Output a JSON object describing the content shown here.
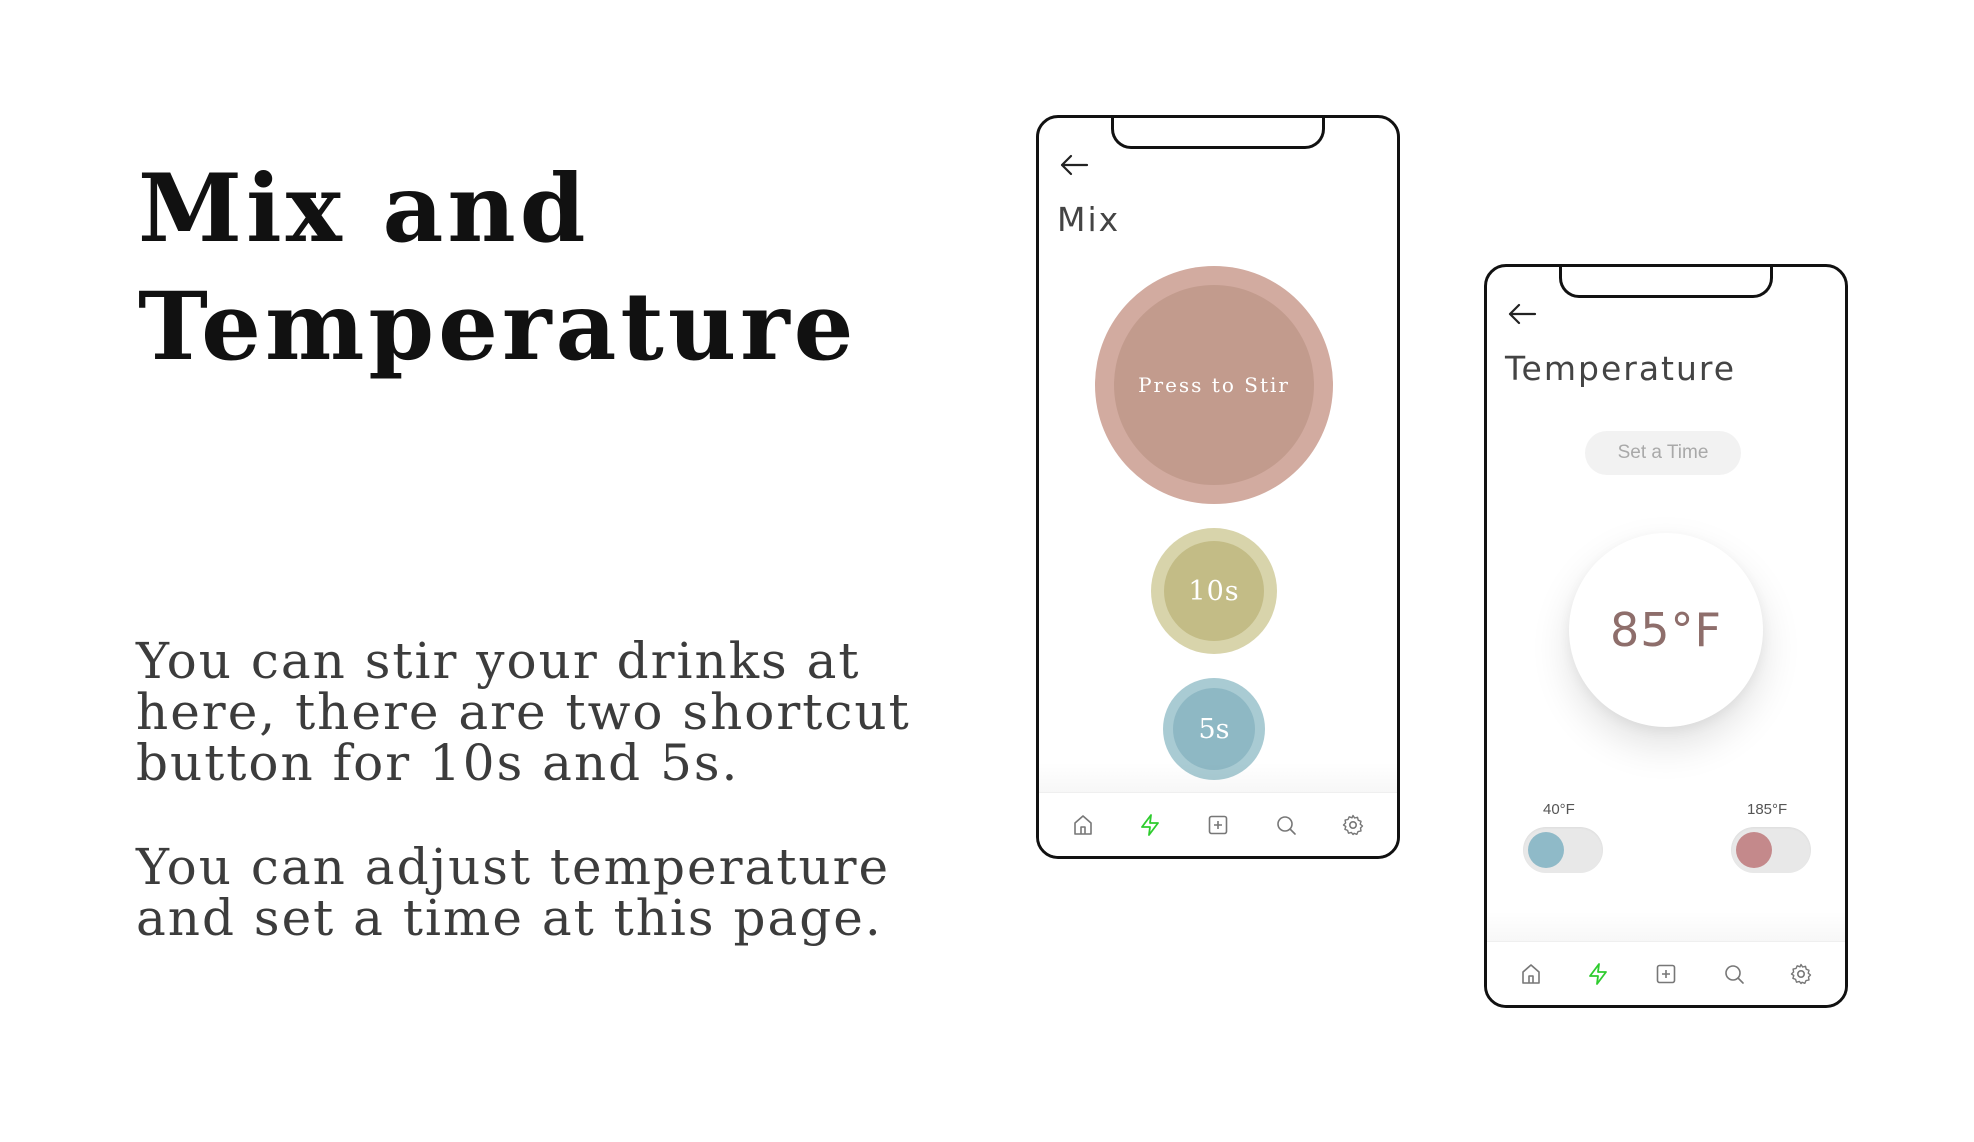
{
  "slide": {
    "title_line1": "Mix and",
    "title_line2": "Temperature",
    "description_mix_line1": "You can stir your drinks at",
    "description_mix_line2": "here, there are two shortcut",
    "description_mix_line3": "button for 10s and 5s.",
    "description_temp_line1": "You can adjust temperature",
    "description_temp_line2": "and set a time at this page."
  },
  "mix_screen": {
    "title": "Mix",
    "stir_button_label": "Press to Stir",
    "shortcut_10s_label": "10s",
    "shortcut_5s_label": "5s"
  },
  "temperature_screen": {
    "title": "Temperature",
    "set_time_label": "Set a Time",
    "current_temperature": "85°F",
    "min_label": "40°F",
    "max_label": "185°F"
  },
  "bottom_nav": {
    "items": [
      "home-icon",
      "lightning-icon",
      "add-square-icon",
      "search-icon",
      "settings-icon"
    ],
    "active_index": 1
  },
  "colors": {
    "stir_outer": "#d2aba0",
    "stir_inner": "#c29b8d",
    "ten_outer": "#d8d4ab",
    "ten_inner": "#c3bc86",
    "five_outer": "#a9cbd3",
    "five_inner": "#8eb8c4",
    "min_knob": "#8fbac8",
    "max_knob": "#c4898b",
    "nav_active": "#2ecc2e",
    "nav_inactive": "#777777"
  }
}
